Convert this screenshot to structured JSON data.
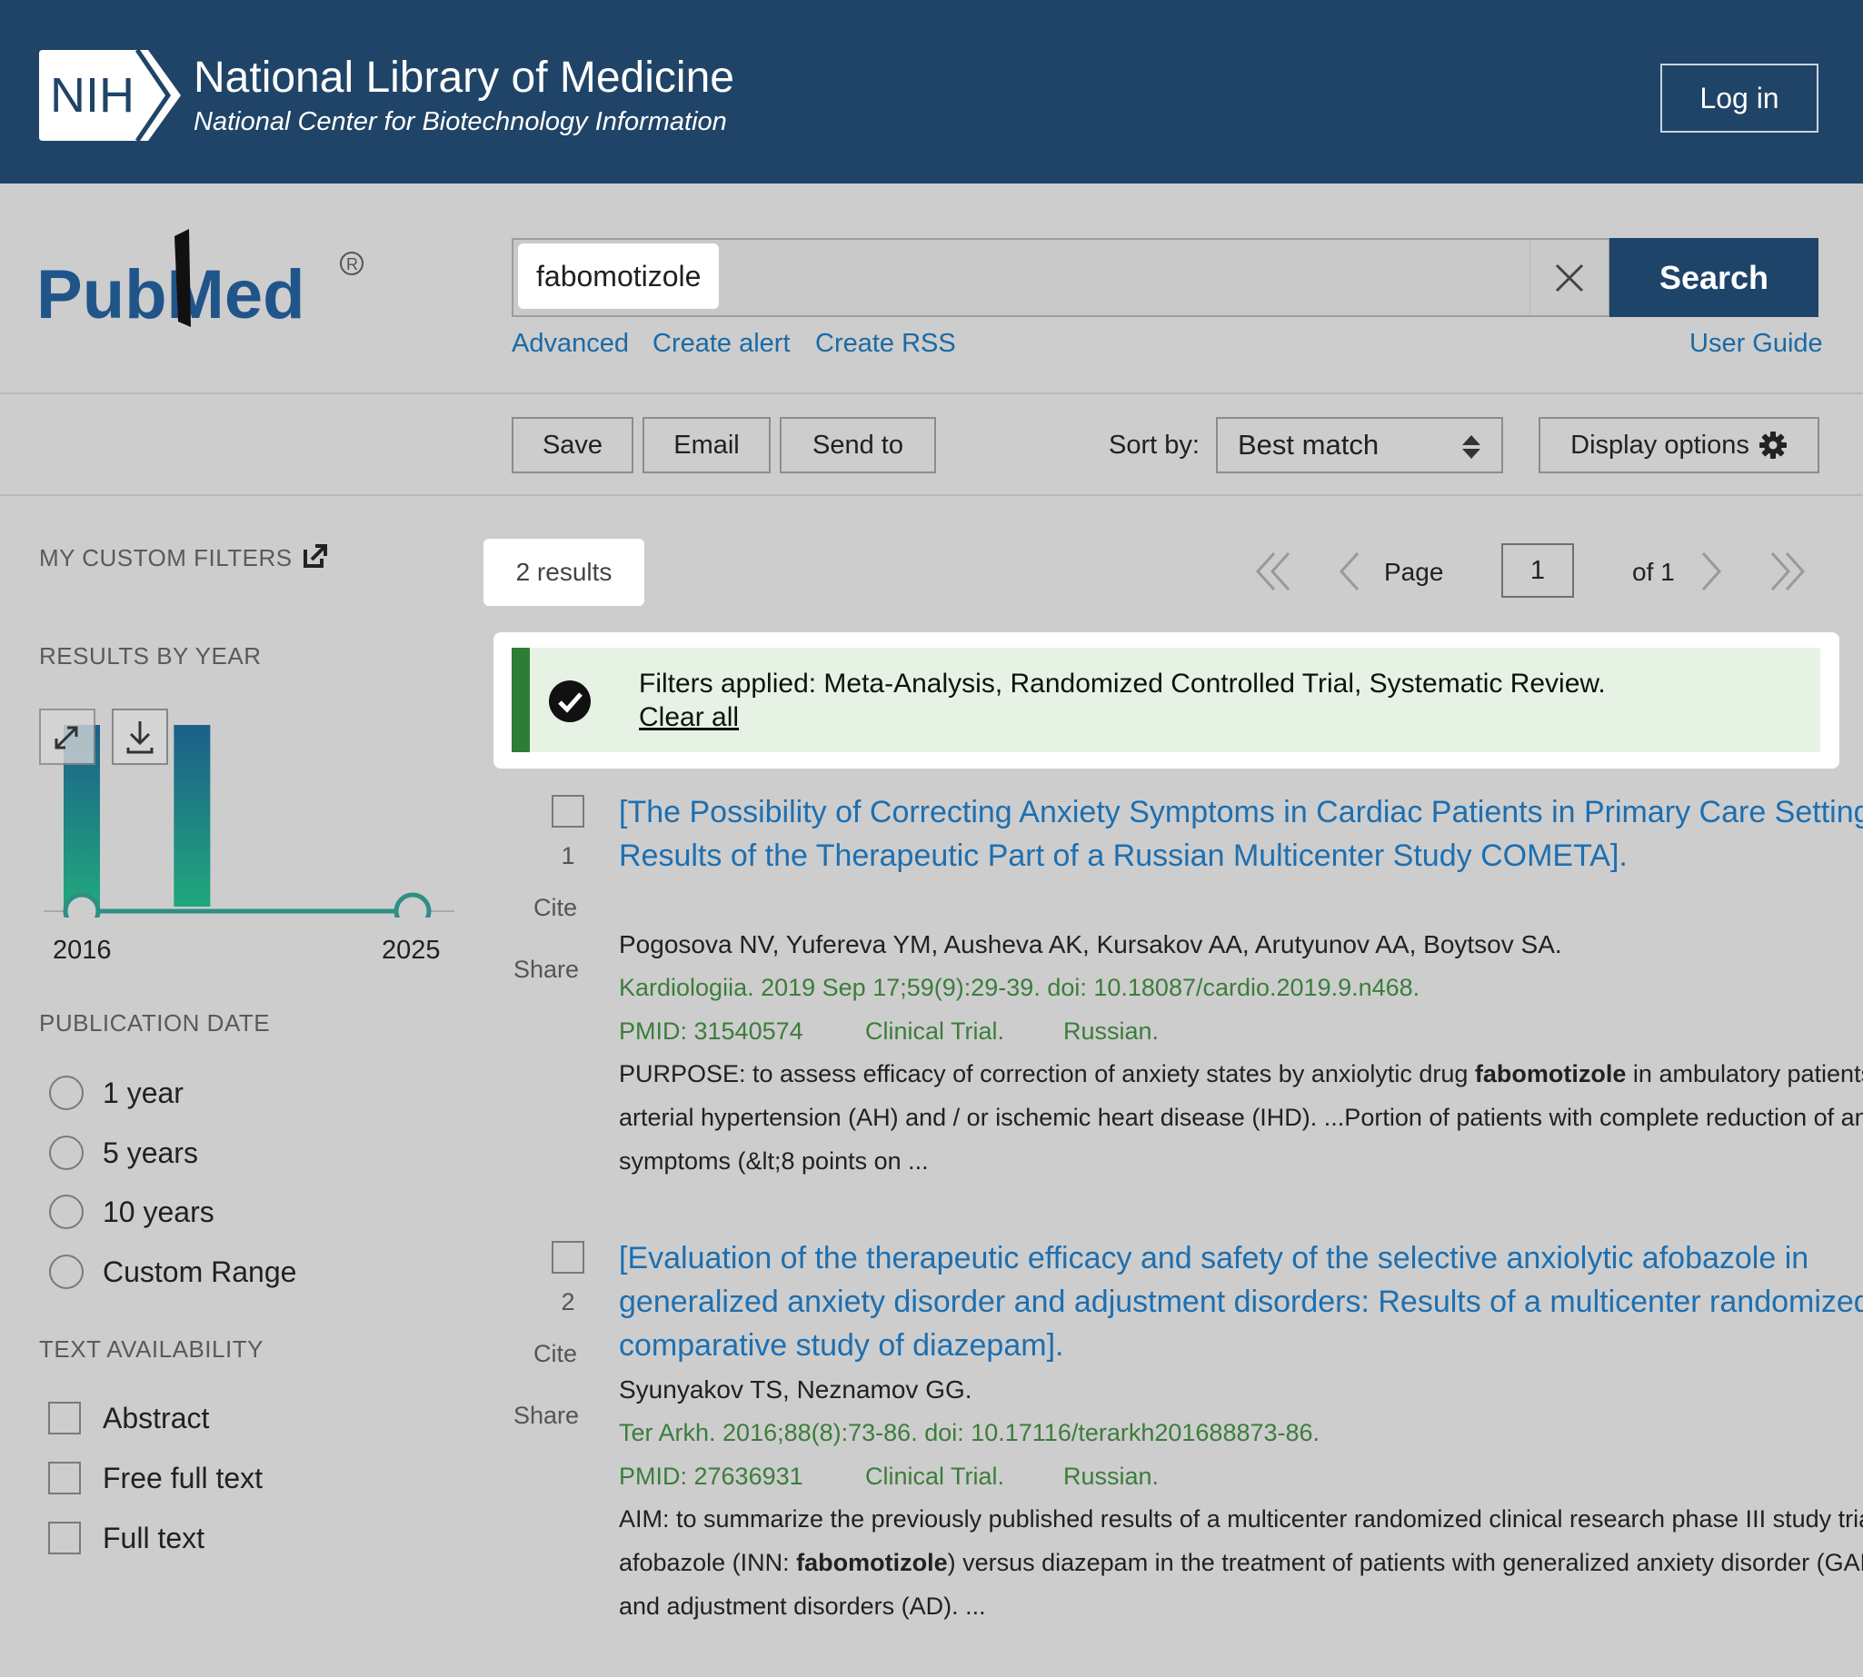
{
  "header": {
    "logo_text": "NIH",
    "title": "National Library of Medicine",
    "subtitle": "National Center for Biotechnology Information",
    "login_label": "Log in"
  },
  "search": {
    "logo_text": "PubMed",
    "query": "fabomotizole",
    "search_label": "Search",
    "links": [
      "Advanced",
      "Create alert",
      "Create RSS"
    ],
    "user_guide": "User Guide"
  },
  "toolbar": {
    "save": "Save",
    "email": "Email",
    "send_to": "Send to",
    "sort_label": "Sort by:",
    "sort_value": "Best match",
    "display_options": "Display options"
  },
  "sidebar": {
    "custom_filters": "MY CUSTOM FILTERS",
    "results_by_year": "RESULTS BY YEAR",
    "year_start": "2016",
    "year_end": "2025",
    "publication_date": "PUBLICATION DATE",
    "date_options": [
      "1 year",
      "5 years",
      "10 years",
      "Custom Range"
    ],
    "text_availability": "TEXT AVAILABILITY",
    "text_options": [
      "Abstract",
      "Free full text",
      "Full text"
    ]
  },
  "chart_data": {
    "type": "bar",
    "categories": [
      "2016",
      "2019"
    ],
    "values": [
      1,
      1
    ]
  },
  "results": {
    "count": "2 results",
    "pagination": {
      "page_label": "Page",
      "page": "1",
      "of": "of 1"
    },
    "filters_applied": "Filters applied: Meta-Analysis, Randomized Controlled Trial, Systematic Review.",
    "clear_all": "Clear all",
    "cite": "Cite",
    "share": "Share",
    "items": [
      {
        "num": "1",
        "title": "[The Possibility of Correcting Anxiety Symptoms in Cardiac Patients in Primary Care Settings: Results of the Therapeutic Part of a Russian Multicenter Study COMETA].",
        "authors": "Pogosova NV, Yufereva YM, Ausheva AK, Kursakov AA, Arutyunov AA, Boytsov SA.",
        "citation": "Kardiologiia. 2019 Sep 17;59(9):29-39. doi: 10.18087/cardio.2019.9.n468.",
        "pmid": "PMID: 31540574",
        "type": "Clinical Trial.",
        "lang": "Russian.",
        "snippet_a": "PURPOSE: to assess efficacy of correction of anxiety states by anxiolytic drug ",
        "snippet_bold": "fabomotizole",
        "snippet_b": " in ambulatory patients with arterial hypertension (AH) and / or ischemic heart disease (IHD). ...Portion of patients with complete reduction of anxiety symptoms (&lt;8 points on ..."
      },
      {
        "num": "2",
        "title": "[Evaluation of the therapeutic efficacy and safety of the selective anxiolytic afobazole in generalized anxiety disorder and adjustment disorders: Results of a multicenter randomized comparative study of diazepam].",
        "authors": "Syunyakov TS, Neznamov GG.",
        "citation": "Ter Arkh. 2016;88(8):73-86. doi: 10.17116/terarkh201688873-86.",
        "pmid": "PMID: 27636931",
        "type": "Clinical Trial.",
        "lang": "Russian.",
        "snippet_a": "AIM: to summarize the previously published results of a multicenter randomized clinical research phase III study trial of afobazole (INN: ",
        "snippet_bold": "fabomotizole",
        "snippet_b": ") versus diazepam in the treatment of patients with generalized anxiety disorder (GAD) and adjustment disorders (AD). ..."
      }
    ]
  }
}
